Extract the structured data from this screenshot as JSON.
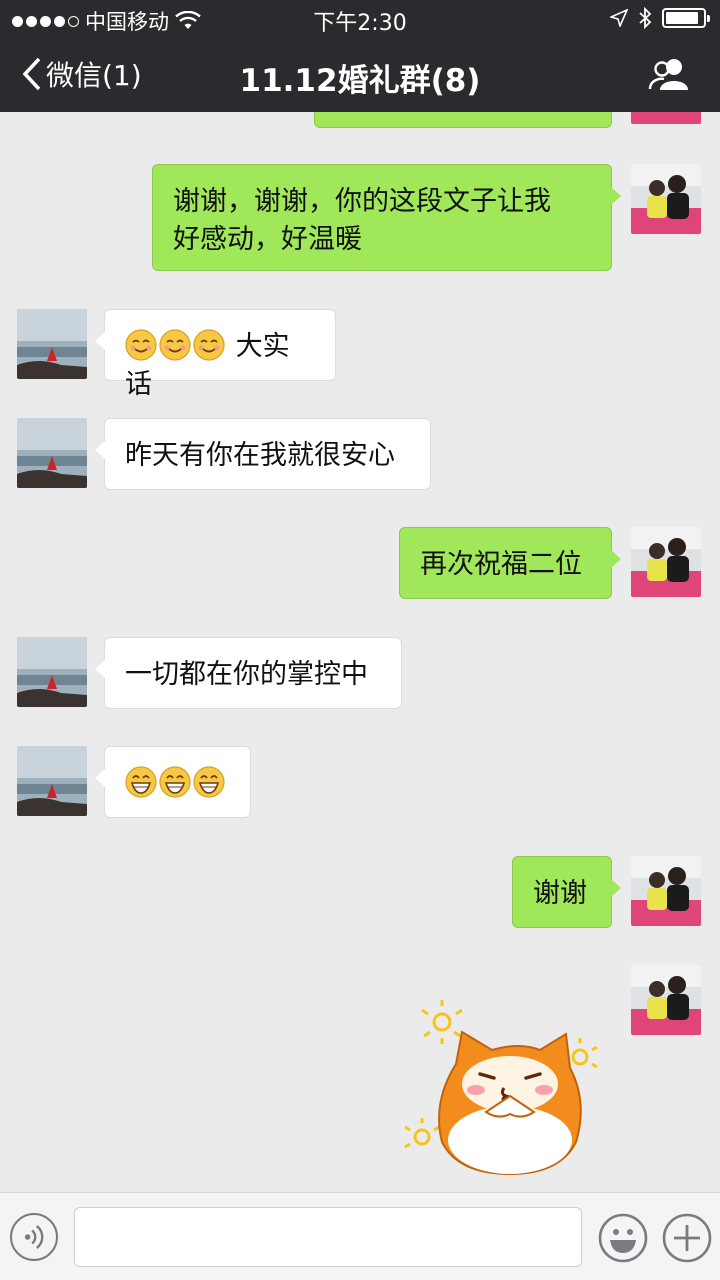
{
  "status_bar": {
    "carrier": "中国移动",
    "time": "下午2:30",
    "signal_icon": "signal-dots-icon",
    "wifi_icon": "wifi-icon",
    "location_icon": "location-arrow-icon",
    "bluetooth_icon": "bluetooth-icon",
    "battery_icon": "battery-icon",
    "battery_level": 0.9
  },
  "nav": {
    "back_label": "微信(1)",
    "title": "11.12婚礼群(8)",
    "members_icon": "group-members-icon"
  },
  "colors": {
    "topbar": "#2b2b2f",
    "chat_bg": "#ebebeb",
    "sent_bubble": "#a0e75a",
    "received_bubble": "#ffffff"
  },
  "messages": [
    {
      "side": "right",
      "text": "",
      "partial": true
    },
    {
      "side": "right",
      "text": "谢谢，谢谢，你的这段文子让我\n好感动，好温暖"
    },
    {
      "side": "left",
      "emoji": "smiling-face-icon",
      "emoji_count": 3,
      "text": "大实话"
    },
    {
      "side": "left",
      "text": "昨天有你在我就很安心"
    },
    {
      "side": "right",
      "text": "再次祝福二位"
    },
    {
      "side": "left",
      "text": "一切都在你的掌控中"
    },
    {
      "side": "left",
      "emoji": "grinning-face-icon",
      "emoji_count": 3,
      "text": ""
    },
    {
      "side": "right",
      "text": "谢谢"
    },
    {
      "side": "right",
      "sticker": "orange-cat-sticker-icon"
    }
  ],
  "input_bar": {
    "voice_icon": "voice-input-icon",
    "emoji_icon": "emoji-picker-icon",
    "plus_icon": "plus-icon",
    "placeholder": ""
  }
}
